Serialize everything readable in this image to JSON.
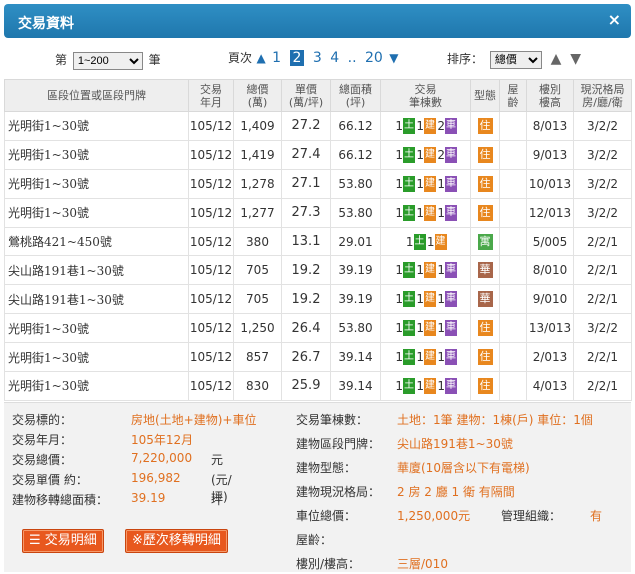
{
  "title": "交易資料",
  "close_glyph": "×",
  "controls": {
    "range_prefix": "第",
    "range_value": "1~200",
    "range_suffix": "筆",
    "page_label": "頁次",
    "pages": [
      "1",
      "2",
      "3",
      "4",
      "..",
      "20"
    ],
    "current_page": "2",
    "sort_label": "排序：",
    "sort_value": "總價"
  },
  "headers": {
    "addr": "區段位置或區段門牌",
    "date": [
      "交易",
      "年月"
    ],
    "total": [
      "總價",
      "(萬)"
    ],
    "unit": [
      "單價",
      "(萬/坪)"
    ],
    "area": [
      "總面積",
      "(坪)"
    ],
    "count": [
      "交易",
      "筆棟數"
    ],
    "type": "型態",
    "age": [
      "屋",
      "齡"
    ],
    "floor": [
      "樓別",
      "樓高"
    ],
    "layout": [
      "現況格局",
      "房/廳/衛"
    ]
  },
  "tag_labels": {
    "land": "土",
    "bldg": "建",
    "car": "車"
  },
  "rows": [
    {
      "addr": "光明街1~30號",
      "date": "105/12",
      "total": "1,409",
      "unit": "27.2",
      "area": "66.12",
      "land": "1",
      "bldg": "1",
      "car": "2",
      "type": "住",
      "type_color": "#e8871e",
      "age": "",
      "floor": "8/013",
      "layout": "3/2/2"
    },
    {
      "addr": "光明街1~30號",
      "date": "105/12",
      "total": "1,419",
      "unit": "27.4",
      "area": "66.12",
      "land": "1",
      "bldg": "1",
      "car": "2",
      "type": "住",
      "type_color": "#e8871e",
      "age": "",
      "floor": "9/013",
      "layout": "3/2/2"
    },
    {
      "addr": "光明街1~30號",
      "date": "105/12",
      "total": "1,278",
      "unit": "27.1",
      "area": "53.80",
      "land": "1",
      "bldg": "1",
      "car": "1",
      "type": "住",
      "type_color": "#e8871e",
      "age": "",
      "floor": "10/013",
      "layout": "3/2/2"
    },
    {
      "addr": "光明街1~30號",
      "date": "105/12",
      "total": "1,277",
      "unit": "27.3",
      "area": "53.80",
      "land": "1",
      "bldg": "1",
      "car": "1",
      "type": "住",
      "type_color": "#e8871e",
      "age": "",
      "floor": "12/013",
      "layout": "3/2/2"
    },
    {
      "addr": "鶯桃路421~450號",
      "date": "105/12",
      "total": "380",
      "unit": "13.1",
      "area": "29.01",
      "land": "1",
      "bldg": "1",
      "car": "",
      "type": "寓",
      "type_color": "#4aa84a",
      "age": "",
      "floor": "5/005",
      "layout": "2/2/1"
    },
    {
      "addr": "尖山路191巷1~30號",
      "date": "105/12",
      "total": "705",
      "unit": "19.2",
      "area": "39.19",
      "land": "1",
      "bldg": "1",
      "car": "1",
      "type": "華",
      "type_color": "#a8664a",
      "age": "",
      "floor": "8/010",
      "layout": "2/2/1"
    },
    {
      "addr": "尖山路191巷1~30號",
      "date": "105/12",
      "total": "705",
      "unit": "19.2",
      "area": "39.19",
      "land": "1",
      "bldg": "1",
      "car": "1",
      "type": "華",
      "type_color": "#a8664a",
      "age": "",
      "floor": "9/010",
      "layout": "2/2/1"
    },
    {
      "addr": "光明街1~30號",
      "date": "105/12",
      "total": "1,250",
      "unit": "26.4",
      "area": "53.80",
      "land": "1",
      "bldg": "1",
      "car": "1",
      "type": "住",
      "type_color": "#e8871e",
      "age": "",
      "floor": "13/013",
      "layout": "3/2/2"
    },
    {
      "addr": "光明街1~30號",
      "date": "105/12",
      "total": "857",
      "unit": "26.7",
      "area": "39.14",
      "land": "1",
      "bldg": "1",
      "car": "1",
      "type": "住",
      "type_color": "#e8871e",
      "age": "",
      "floor": "2/013",
      "layout": "2/2/1"
    },
    {
      "addr": "光明街1~30號",
      "date": "105/12",
      "total": "830",
      "unit": "25.9",
      "area": "39.14",
      "land": "1",
      "bldg": "1",
      "car": "1",
      "type": "住",
      "type_color": "#e8871e",
      "age": "",
      "floor": "4/013",
      "layout": "2/2/1"
    }
  ],
  "detail": {
    "left": [
      {
        "label": "交易標的：",
        "value": "房地(土地+建物)+車位",
        "unit": ""
      },
      {
        "label": "交易年月：",
        "value": "105年12月",
        "unit": ""
      },
      {
        "label": "交易總價：",
        "value": "7,220,000",
        "unit": "元"
      },
      {
        "label": "交易單價 約：",
        "value": "196,982",
        "unit": "(元/坪)"
      },
      {
        "label": "建物移轉總面積：",
        "value": "39.19",
        "unit": "坪"
      }
    ],
    "right": [
      {
        "label": "交易筆棟數：",
        "value": "土地：1筆 建物：1棟(戶) 車位：1個"
      },
      {
        "label": "建物區段門牌：",
        "value": "尖山路191巷1~30號"
      },
      {
        "label": "建物型態：",
        "value": "華廈(10層含以下有電梯)"
      },
      {
        "label": "建物現況格局：",
        "value": "2 房 2 廳 1 衛 有隔間"
      },
      {
        "label": "車位總價：",
        "value": "1,250,000元"
      },
      {
        "label": "屋齡：",
        "value": ""
      },
      {
        "label": "樓別/樓高：",
        "value": "三層/010"
      }
    ],
    "mgmt_label": "管理組織：",
    "mgmt_value": "有",
    "btn_detail": "交易明細",
    "btn_history": "※歷次移轉明細"
  }
}
